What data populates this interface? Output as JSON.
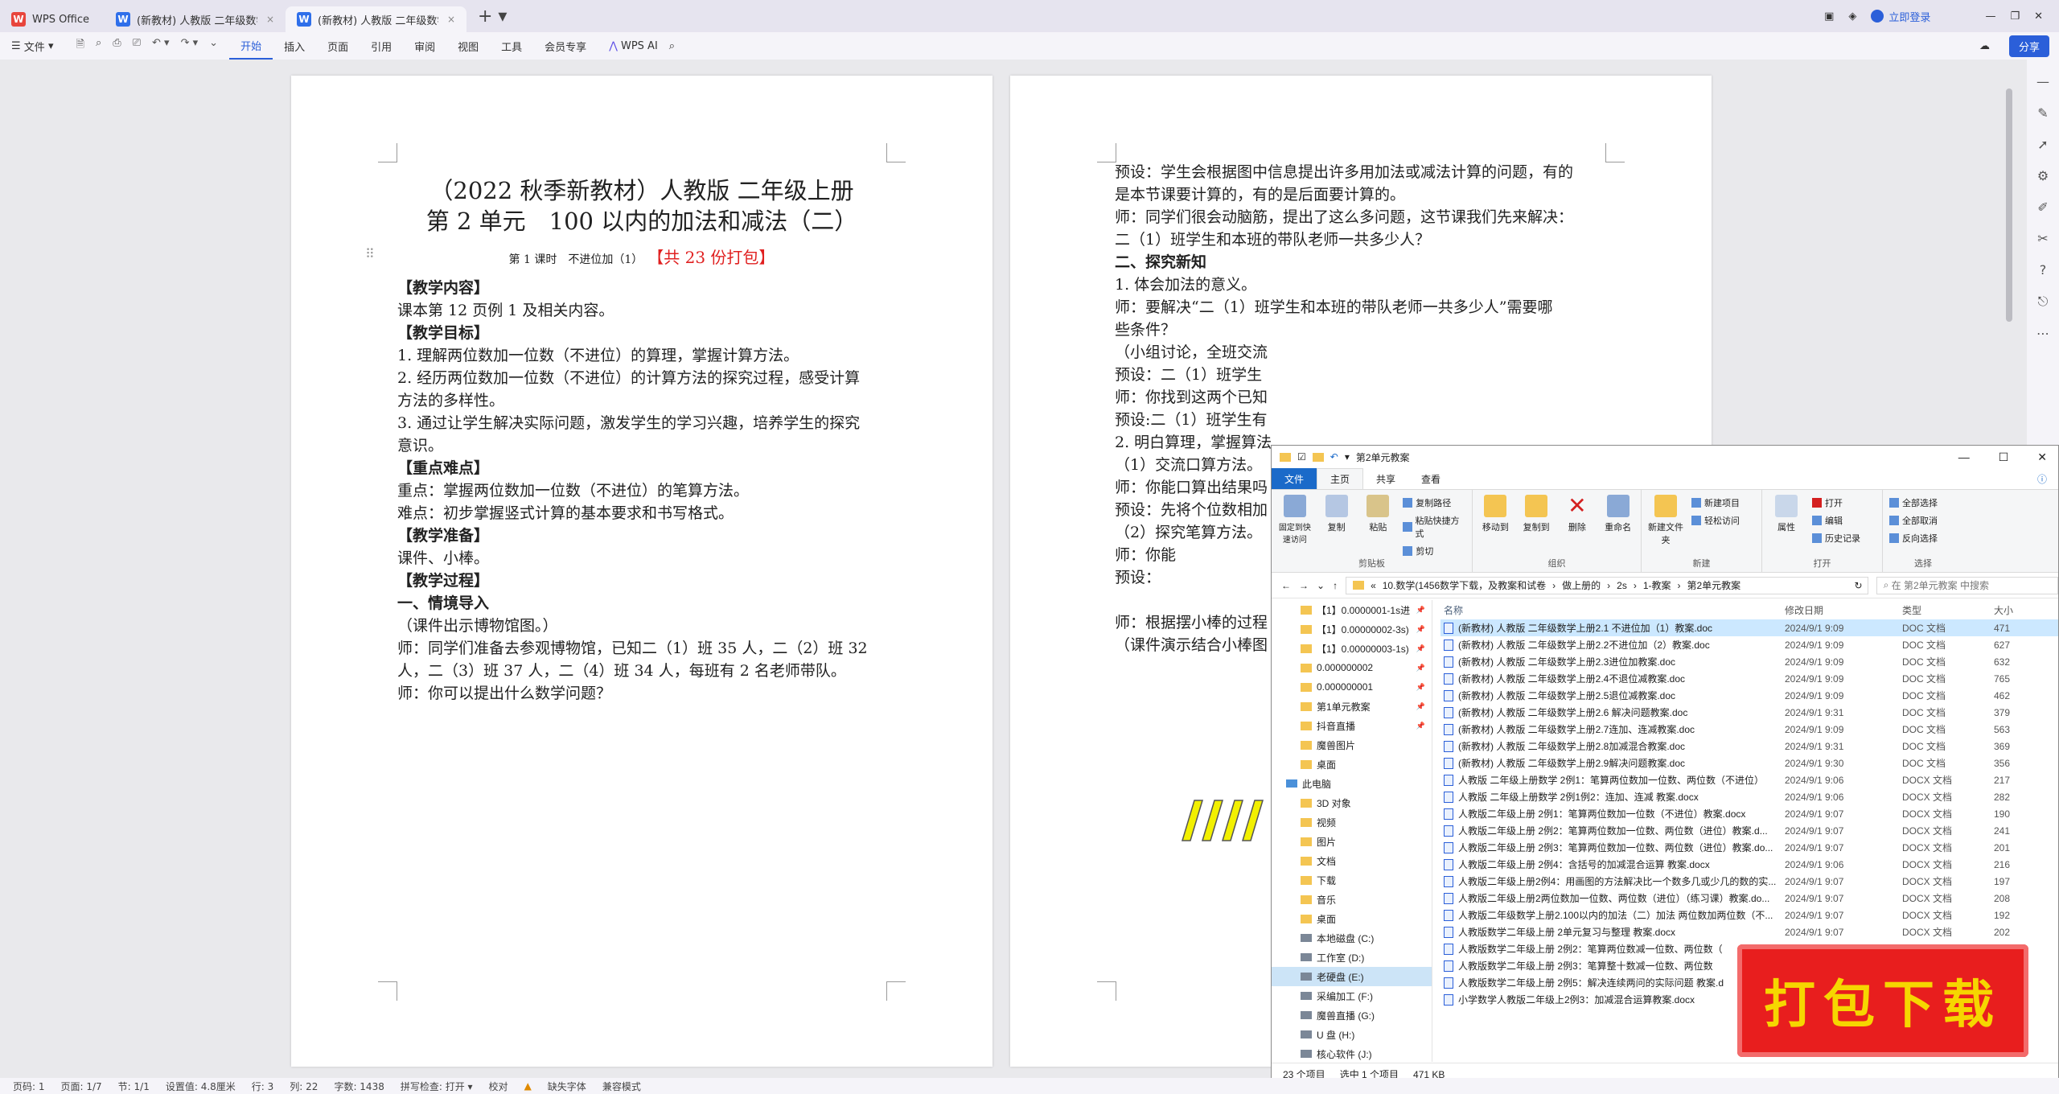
{
  "titlebar": {
    "tabs": [
      {
        "label": "WPS Office"
      },
      {
        "label": "(新教材) 人教版 二年级数学上册"
      },
      {
        "label": "(新教材) 人教版 二年级数学"
      }
    ],
    "login": "立即登录"
  },
  "menubar": {
    "file": "文件",
    "items": [
      "开始",
      "插入",
      "页面",
      "引用",
      "审阅",
      "视图",
      "工具",
      "会员专享"
    ],
    "wps_ai": "WPS AI",
    "share": "分享"
  },
  "page1": {
    "title1": "（2022 秋季新教材）人教版 二年级上册",
    "title2": "第 2 单元　100 以内的加法和减法（二）",
    "subtitle": "第 1 课时　不进位加（1）",
    "subtitle_red": "【共 23 份打包】",
    "lines": [
      {
        "text": "【教学内容】",
        "bold": true
      },
      {
        "text": "课本第 12 页例 1 及相关内容。",
        "bold": false
      },
      {
        "text": "【教学目标】",
        "bold": true
      },
      {
        "text": "1. 理解两位数加一位数（不进位）的算理，掌握计算方法。",
        "bold": false
      },
      {
        "text": "2. 经历两位数加一位数（不进位）的计算方法的探究过程，感受计算",
        "bold": false
      },
      {
        "text": "方法的多样性。",
        "bold": false
      },
      {
        "text": "3. 通过让学生解决实际问题，激发学生的学习兴趣，培养学生的探究",
        "bold": false
      },
      {
        "text": "意识。",
        "bold": false
      },
      {
        "text": "【重点难点】",
        "bold": true
      },
      {
        "text": "重点：掌握两位数加一位数（不进位）的笔算方法。",
        "bold": false
      },
      {
        "text": "难点：初步掌握竖式计算的基本要求和书写格式。",
        "bold": false
      },
      {
        "text": "【教学准备】",
        "bold": true
      },
      {
        "text": "课件、小棒。",
        "bold": false
      },
      {
        "text": "【教学过程】",
        "bold": true
      },
      {
        "text": "一、情境导入",
        "bold": true
      },
      {
        "text": "（课件出示博物馆图。）",
        "bold": false
      },
      {
        "text": "师：同学们准备去参观博物馆，已知二（1）班 35 人，二（2）班 32",
        "bold": false
      },
      {
        "text": "人，二（3）班 37 人，二（4）班 34 人，每班有 2 名老师带队。",
        "bold": false
      },
      {
        "text": "师：你可以提出什么数学问题？",
        "bold": false
      }
    ]
  },
  "page2": {
    "lines": [
      {
        "text": "预设：学生会根据图中信息提出许多用加法或减法计算的问题，有的",
        "bold": false
      },
      {
        "text": "是本节课要计算的，有的是后面要计算的。",
        "bold": false
      },
      {
        "text": "师：同学们很会动脑筋，提出了这么多问题，这节课我们先来解决：",
        "bold": false
      },
      {
        "text": "二（1）班学生和本班的带队老师一共多少人？",
        "bold": false
      },
      {
        "text": "二、探究新知",
        "bold": true
      },
      {
        "text": "1. 体会加法的意义。",
        "bold": false
      },
      {
        "text": "师：要解决“二（1）班学生和本班的带队老师一共多少人”需要哪",
        "bold": false
      },
      {
        "text": "些条件？",
        "bold": false
      },
      {
        "text": "（小组讨论，全班交流",
        "bold": false
      },
      {
        "text": "预设：二（1）班学生",
        "bold": false
      },
      {
        "text": "师：你找到这两个已知",
        "bold": false
      },
      {
        "text": "预设:二（1）班学生有",
        "bold": false
      },
      {
        "text": "2. 明白算理，掌握算法",
        "bold": false
      },
      {
        "text": "（1）交流口算方法。",
        "bold": false
      },
      {
        "text": "师：你能口算出结果吗",
        "bold": false
      },
      {
        "text": "预设：先将个位数相加",
        "bold": false
      },
      {
        "text": "（2）探究笔算方法。",
        "bold": false
      },
      {
        "text": "师：你能",
        "bold": false
      },
      {
        "text": "预设：",
        "bold": false
      },
      {
        "text": "",
        "bold": false
      },
      {
        "text": "师：根据摆小棒的过程",
        "bold": false
      },
      {
        "text": "（课件演示结合小棒图",
        "bold": false
      }
    ]
  },
  "explorer": {
    "title": "第2单元教案",
    "tabs": [
      "文件",
      "主页",
      "共享",
      "查看"
    ],
    "ribbon": {
      "clipboard": {
        "label": "剪贴板",
        "pin": "固定到快速访问",
        "copy": "复制",
        "paste": "粘贴",
        "copy_path": "复制路径",
        "paste_shortcut": "粘贴快捷方式",
        "cut": "剪切"
      },
      "organize": {
        "label": "组织",
        "move_to": "移动到",
        "copy_to": "复制到",
        "delete": "删除",
        "rename": "重命名"
      },
      "new": {
        "label": "新建",
        "new_folder": "新建文件夹",
        "new_item": "新建项目",
        "easy_access": "轻松访问"
      },
      "open": {
        "label": "打开",
        "properties": "属性",
        "open": "打开",
        "edit": "编辑",
        "history": "历史记录"
      },
      "select": {
        "label": "选择",
        "select_all": "全部选择",
        "select_none": "全部取消",
        "invert": "反向选择"
      }
    },
    "address": [
      "10.数学(1456数学下载，及教案和试卷",
      "做上册的",
      "2s",
      "1-教案",
      "第2单元教案"
    ],
    "search_placeholder": "在 第2单元教案 中搜索",
    "nav": [
      {
        "label": "【1】0.0000001-1s进",
        "type": "folder",
        "pin": true
      },
      {
        "label": "【1】0.00000002-3s)",
        "type": "folder",
        "pin": true
      },
      {
        "label": "【1】0.00000003-1s)",
        "type": "folder",
        "pin": true
      },
      {
        "label": "0.000000002",
        "type": "folder",
        "pin": true
      },
      {
        "label": "0.000000001",
        "type": "folder",
        "pin": true
      },
      {
        "label": "第1单元教案",
        "type": "folder",
        "pin": true
      },
      {
        "label": "抖音直播",
        "type": "folder",
        "pin": true
      },
      {
        "label": "魔兽图片",
        "type": "folder",
        "pin": false
      },
      {
        "label": "桌面",
        "type": "folder",
        "pin": false
      },
      {
        "label": "此电脑",
        "type": "pc",
        "pin": false
      },
      {
        "label": "3D 对象",
        "type": "folder",
        "pin": false
      },
      {
        "label": "视频",
        "type": "folder",
        "pin": false
      },
      {
        "label": "图片",
        "type": "folder",
        "pin": false
      },
      {
        "label": "文档",
        "type": "folder",
        "pin": false
      },
      {
        "label": "下载",
        "type": "folder",
        "pin": false
      },
      {
        "label": "音乐",
        "type": "folder",
        "pin": false
      },
      {
        "label": "桌面",
        "type": "folder",
        "pin": false
      },
      {
        "label": "本地磁盘 (C:)",
        "type": "drive",
        "pin": false
      },
      {
        "label": "工作室 (D:)",
        "type": "drive",
        "pin": false
      },
      {
        "label": "老硬盘 (E:)",
        "type": "drive",
        "pin": false,
        "selected": true
      },
      {
        "label": "采编加工 (F:)",
        "type": "drive",
        "pin": false
      },
      {
        "label": "魔兽直播 (G:)",
        "type": "drive",
        "pin": false
      },
      {
        "label": "U 盘 (H:)",
        "type": "drive",
        "pin": false
      },
      {
        "label": "核心软件 (J:)",
        "type": "drive",
        "pin": false
      }
    ],
    "columns": [
      "名称",
      "修改日期",
      "类型",
      "大小"
    ],
    "files": [
      {
        "name": "(新教材) 人教版 二年级数学上册2.1 不进位加（1）教案.doc",
        "date": "2024/9/1 9:09",
        "type": "DOC 文档",
        "size": "471",
        "selected": true
      },
      {
        "name": "(新教材) 人教版 二年级数学上册2.2不进位加（2）教案.doc",
        "date": "2024/9/1 9:09",
        "type": "DOC 文档",
        "size": "627"
      },
      {
        "name": "(新教材) 人教版 二年级数学上册2.3进位加教案.doc",
        "date": "2024/9/1 9:09",
        "type": "DOC 文档",
        "size": "632"
      },
      {
        "name": "(新教材) 人教版 二年级数学上册2.4不退位减教案.doc",
        "date": "2024/9/1 9:09",
        "type": "DOC 文档",
        "size": "765"
      },
      {
        "name": "(新教材) 人教版 二年级数学上册2.5退位减教案.doc",
        "date": "2024/9/1 9:09",
        "type": "DOC 文档",
        "size": "462"
      },
      {
        "name": "(新教材) 人教版 二年级数学上册2.6 解决问题教案.doc",
        "date": "2024/9/1 9:31",
        "type": "DOC 文档",
        "size": "379"
      },
      {
        "name": "(新教材) 人教版 二年级数学上册2.7连加、连减教案.doc",
        "date": "2024/9/1 9:09",
        "type": "DOC 文档",
        "size": "563"
      },
      {
        "name": "(新教材) 人教版 二年级数学上册2.8加减混合教案.doc",
        "date": "2024/9/1 9:31",
        "type": "DOC 文档",
        "size": "369"
      },
      {
        "name": "(新教材) 人教版 二年级数学上册2.9解决问题教案.doc",
        "date": "2024/9/1 9:30",
        "type": "DOC 文档",
        "size": "356"
      },
      {
        "name": "人教版 二年级上册数学 2例1：笔算两位数加一位数、两位数（不进位）",
        "date": "2024/9/1 9:06",
        "type": "DOCX 文档",
        "size": "217"
      },
      {
        "name": "人教版 二年级上册数学 2例1例2：连加、连减 教案.docx",
        "date": "2024/9/1 9:06",
        "type": "DOCX 文档",
        "size": "282"
      },
      {
        "name": "人教版二年级上册 2例1：笔算两位数加一位数（不进位）教案.docx",
        "date": "2024/9/1 9:07",
        "type": "DOCX 文档",
        "size": "190"
      },
      {
        "name": "人教版二年级上册 2例2：笔算两位数加一位数、两位数（进位）教案.d...",
        "date": "2024/9/1 9:07",
        "type": "DOCX 文档",
        "size": "241"
      },
      {
        "name": "人教版二年级上册 2例3：笔算两位数加一位数、两位数（进位）教案.do...",
        "date": "2024/9/1 9:07",
        "type": "DOCX 文档",
        "size": "201"
      },
      {
        "name": "人教版二年级上册 2例4：含括号的加减混合运算 教案.docx",
        "date": "2024/9/1 9:06",
        "type": "DOCX 文档",
        "size": "216"
      },
      {
        "name": "人教版二年级上册2例4：用画图的方法解决比一个数多几或少几的数的实...",
        "date": "2024/9/1 9:07",
        "type": "DOCX 文档",
        "size": "197"
      },
      {
        "name": "人教版二年级上册2两位数加一位数、两位数（进位）（练习课）教案.do...",
        "date": "2024/9/1 9:07",
        "type": "DOCX 文档",
        "size": "208"
      },
      {
        "name": "人教版二年级数学上册2.100以内的加法（二）加法 两位数加两位数（不...",
        "date": "2024/9/1 9:07",
        "type": "DOCX 文档",
        "size": "192"
      },
      {
        "name": "人教版数学二年级上册 2单元复习与整理 教案.docx",
        "date": "2024/9/1 9:07",
        "type": "DOCX 文档",
        "size": "202"
      },
      {
        "name": "人教版数学二年级上册 2例2：笔算两位数减一位数、两位数（",
        "date": "",
        "type": "",
        "size": "195"
      },
      {
        "name": "人教版数学二年级上册 2例3：笔算整十数减一位数、两位数",
        "date": "",
        "type": "",
        "size": "337"
      },
      {
        "name": "人教版数学二年级上册 2例5：解决连续两问的实际问题 教案.d",
        "date": "",
        "type": "",
        "size": "212"
      },
      {
        "name": "小学数学人教版二年级上2例3：加减混合运算教案.docx",
        "date": "",
        "type": "",
        "size": "215"
      }
    ],
    "status": {
      "count": "23 个项目",
      "selected": "选中 1 个项目",
      "size": "471 KB"
    }
  },
  "stamp": "打包下载",
  "statusbar": {
    "page": "页码: 1",
    "pages": "页面: 1/7",
    "section": "节: 1/1",
    "setting": "设置值: 4.8厘米",
    "row": "行: 3",
    "col": "列: 22",
    "words": "字数: 1438",
    "spell": "拼写检查: 打开 ▾",
    "proof": "校对",
    "missing_font": "缺失字体",
    "compat": "兼容模式"
  },
  "colors": {
    "accent": "#2b5fd9",
    "wps_red": "#e8453c",
    "stamp_red": "#e81e1e",
    "stamp_yellow": "#f6d600"
  }
}
